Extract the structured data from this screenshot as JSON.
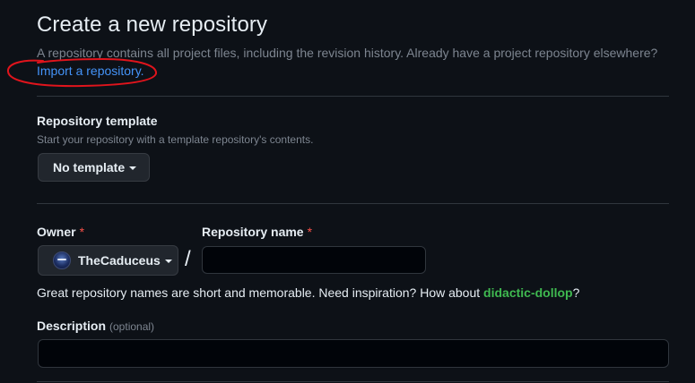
{
  "header": {
    "title": "Create a new repository",
    "subtitle": "A repository contains all project files, including the revision history. Already have a project repository elsewhere?",
    "import_link": "Import a repository."
  },
  "template": {
    "label": "Repository template",
    "hint": "Start your repository with a template repository's contents.",
    "button_label": "No template"
  },
  "owner": {
    "label": "Owner",
    "required_mark": "*",
    "value": "TheCaduceus"
  },
  "repo_name": {
    "label": "Repository name",
    "required_mark": "*",
    "value": ""
  },
  "separator": "/",
  "suggestion": {
    "prefix": "Great repository names are short and memorable. Need inspiration? How about ",
    "name": "didactic-dollop",
    "suffix": "?"
  },
  "description": {
    "label": "Description",
    "optional": "(optional)",
    "value": ""
  },
  "colors": {
    "background": "#0d1117",
    "link": "#4493f8",
    "annotation": "#e0141c",
    "required": "#f85149",
    "suggestion": "#3fb950"
  }
}
